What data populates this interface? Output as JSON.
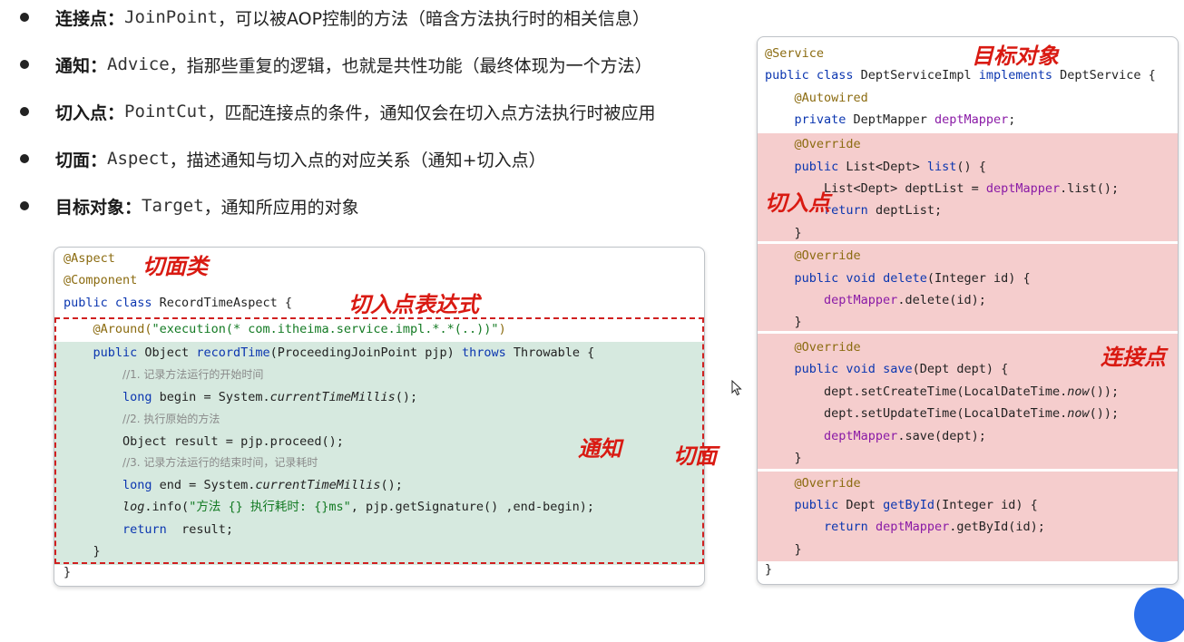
{
  "bullets": [
    {
      "term": "连接点：",
      "word": "JoinPoint",
      "desc": "，可以被AOP控制的方法（暗含方法执行时的相关信息）"
    },
    {
      "term": "通知：",
      "word": "Advice",
      "desc": "，指那些重复的逻辑，也就是共性功能（最终体现为一个方法）"
    },
    {
      "term": "切入点：",
      "word": "PointCut",
      "desc": "，匹配连接点的条件，通知仅会在切入点方法执行时被应用"
    },
    {
      "term": "切面：",
      "word": "Aspect",
      "desc": "，描述通知与切入点的对应关系（通知+切入点）"
    },
    {
      "term": "目标对象：",
      "word": "Target",
      "desc": "，通知所应用的对象"
    }
  ],
  "left_code": [
    [
      [
        "ann",
        "@Aspect"
      ]
    ],
    [
      [
        "ann",
        "@Component"
      ]
    ],
    [
      [
        "kw",
        "public class "
      ],
      [
        "txt",
        "RecordTimeAspect {"
      ]
    ],
    [
      [
        "txt",
        "    "
      ],
      [
        "ann",
        "@Around("
      ],
      [
        "str",
        "\"execution(* com.itheima.service.impl.*.*(..))\""
      ],
      [
        "ann",
        ")"
      ]
    ],
    [
      [
        "txt",
        "    "
      ],
      [
        "kw",
        "public "
      ],
      [
        "txt",
        "Object "
      ],
      [
        "kw",
        "recordTime"
      ],
      [
        "txt",
        "(ProceedingJoinPoint pjp) "
      ],
      [
        "kw",
        "throws "
      ],
      [
        "txt",
        "Throwable {"
      ]
    ],
    [
      [
        "txt",
        "        "
      ],
      [
        "cmt",
        "//1. 记录方法运行的开始时间"
      ]
    ],
    [
      [
        "txt",
        "        "
      ],
      [
        "kw",
        "long "
      ],
      [
        "txt",
        "begin = System."
      ],
      [
        "ital",
        "currentTimeMillis"
      ],
      [
        "txt",
        "();"
      ]
    ],
    [
      [
        "txt",
        "        "
      ],
      [
        "cmt",
        "//2. 执行原始的方法"
      ]
    ],
    [
      [
        "txt",
        "        Object result = pjp.proceed();"
      ]
    ],
    [
      [
        "txt",
        "        "
      ],
      [
        "cmt",
        "//3. 记录方法运行的结束时间，记录耗时"
      ]
    ],
    [
      [
        "txt",
        "        "
      ],
      [
        "kw",
        "long "
      ],
      [
        "txt",
        "end = System."
      ],
      [
        "ital",
        "currentTimeMillis"
      ],
      [
        "txt",
        "();"
      ]
    ],
    [
      [
        "txt",
        "        "
      ],
      [
        "ital",
        "log"
      ],
      [
        "txt",
        ".info("
      ],
      [
        "str",
        "\"方法 {} 执行耗时: {}ms\""
      ],
      [
        "txt",
        ", pjp.getSignature() ,end-begin);"
      ]
    ],
    [
      [
        "txt",
        "        "
      ],
      [
        "kw",
        "return  "
      ],
      [
        "txt",
        "result;"
      ]
    ],
    [
      [
        "txt",
        "    }"
      ]
    ],
    [
      [
        "txt",
        "}"
      ]
    ]
  ],
  "right_code": [
    [
      [
        "ann",
        "@Service"
      ]
    ],
    [
      [
        "kw",
        "public class "
      ],
      [
        "txt",
        "DeptServiceImpl "
      ],
      [
        "kw",
        "implements "
      ],
      [
        "txt",
        "DeptService {"
      ]
    ],
    [
      [
        "txt",
        "    "
      ],
      [
        "ann",
        "@Autowired"
      ]
    ],
    [
      [
        "txt",
        "    "
      ],
      [
        "kw",
        "private "
      ],
      [
        "txt",
        "DeptMapper "
      ],
      [
        "field",
        "deptMapper"
      ],
      [
        "txt",
        ";"
      ]
    ],
    [
      [
        "txt",
        "    "
      ],
      [
        "ann",
        "@Override"
      ]
    ],
    [
      [
        "txt",
        "    "
      ],
      [
        "kw",
        "public "
      ],
      [
        "txt",
        "List<Dept> "
      ],
      [
        "kw",
        "list"
      ],
      [
        "txt",
        "() {"
      ]
    ],
    [
      [
        "txt",
        "        List<Dept> deptList = "
      ],
      [
        "field",
        "deptMapper"
      ],
      [
        "txt",
        ".list();"
      ]
    ],
    [
      [
        "txt",
        "        "
      ],
      [
        "kw",
        "return "
      ],
      [
        "txt",
        "deptList;"
      ]
    ],
    [
      [
        "txt",
        "    }"
      ]
    ],
    [
      [
        "txt",
        "    "
      ],
      [
        "ann",
        "@Override"
      ]
    ],
    [
      [
        "txt",
        "    "
      ],
      [
        "kw",
        "public void "
      ],
      [
        "kw",
        "delete"
      ],
      [
        "txt",
        "(Integer id) {"
      ]
    ],
    [
      [
        "txt",
        "        "
      ],
      [
        "field",
        "deptMapper"
      ],
      [
        "txt",
        ".delete(id);"
      ]
    ],
    [
      [
        "txt",
        "    }"
      ]
    ],
    [
      [
        "txt",
        "    "
      ],
      [
        "ann",
        "@Override"
      ]
    ],
    [
      [
        "txt",
        "    "
      ],
      [
        "kw",
        "public void "
      ],
      [
        "kw",
        "save"
      ],
      [
        "txt",
        "(Dept dept) {"
      ]
    ],
    [
      [
        "txt",
        "        dept.setCreateTime(LocalDateTime."
      ],
      [
        "ital",
        "now"
      ],
      [
        "txt",
        "());"
      ]
    ],
    [
      [
        "txt",
        "        dept.setUpdateTime(LocalDateTime."
      ],
      [
        "ital",
        "now"
      ],
      [
        "txt",
        "());"
      ]
    ],
    [
      [
        "txt",
        "        "
      ],
      [
        "field",
        "deptMapper"
      ],
      [
        "txt",
        ".save(dept);"
      ]
    ],
    [
      [
        "txt",
        "    }"
      ]
    ],
    [
      [
        "txt",
        "    "
      ],
      [
        "ann",
        "@Override"
      ]
    ],
    [
      [
        "txt",
        "    "
      ],
      [
        "kw",
        "public "
      ],
      [
        "txt",
        "Dept "
      ],
      [
        "kw",
        "getById"
      ],
      [
        "txt",
        "(Integer id) {"
      ]
    ],
    [
      [
        "txt",
        "        "
      ],
      [
        "kw",
        "return "
      ],
      [
        "field",
        "deptMapper"
      ],
      [
        "txt",
        ".getById(id);"
      ]
    ],
    [
      [
        "txt",
        "    }"
      ]
    ],
    [
      [
        "txt",
        "}"
      ]
    ]
  ],
  "annotations": {
    "aspect_class": "切面类",
    "pointcut_expr": "切入点表达式",
    "advice": "通知",
    "aspect": "切面",
    "target": "目标对象",
    "pointcut": "切入点",
    "joinpoint": "连接点"
  },
  "colors": {
    "keyword": "#0b36b0",
    "annotation": "#8b6b10",
    "string": "#137a23",
    "comment": "#8a8a8a",
    "field": "#8a1aa6",
    "advice_bg": "#d6e9df",
    "joinpoint_bg": "#f5cdcd",
    "handwriting": "#d91a12"
  }
}
